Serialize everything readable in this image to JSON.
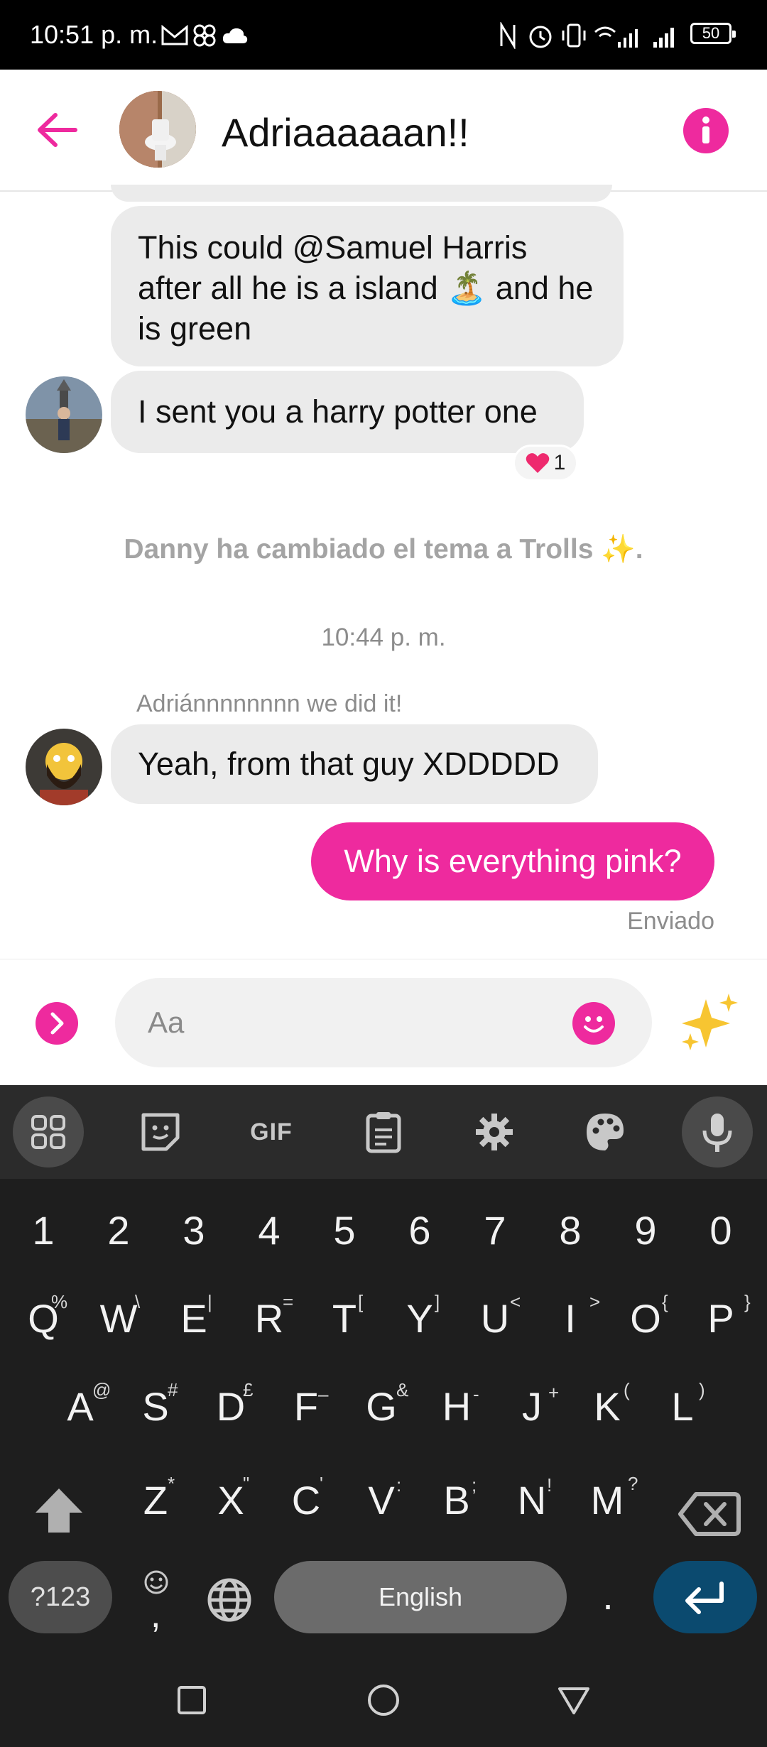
{
  "status_bar": {
    "time": "10:51 p. m.",
    "battery": "50"
  },
  "header": {
    "title": "Adriaaaaaan!!"
  },
  "messages": {
    "msg1": "This could @Samuel Harris after all he is a island 🏝️ and he is green",
    "msg2": "I sent you a harry potter one",
    "reaction_count": "1",
    "system": "Danny ha cambiado el tema a Trolls ✨.",
    "time_separator": "10:44 p. m.",
    "sender_label": "Adriánnnnnnnn we did it!",
    "msg3": "Yeah, from that guy XDDDDD",
    "sent": "Why is everything pink?",
    "sent_status": "Enviado"
  },
  "composer": {
    "placeholder": "Aa"
  },
  "keyboard": {
    "toolbar": [
      "apps-icon",
      "sticker-icon",
      "GIF",
      "clipboard-icon",
      "settings-icon",
      "palette-icon",
      "mic-icon"
    ],
    "gif_label": "GIF",
    "row_numbers": [
      "1",
      "2",
      "3",
      "4",
      "5",
      "6",
      "7",
      "8",
      "9",
      "0"
    ],
    "row1": [
      {
        "k": "Q",
        "s": "%"
      },
      {
        "k": "W",
        "s": "\\"
      },
      {
        "k": "E",
        "s": "|"
      },
      {
        "k": "R",
        "s": "="
      },
      {
        "k": "T",
        "s": "["
      },
      {
        "k": "Y",
        "s": "]"
      },
      {
        "k": "U",
        "s": "<"
      },
      {
        "k": "I",
        "s": ">"
      },
      {
        "k": "O",
        "s": "{"
      },
      {
        "k": "P",
        "s": "}"
      }
    ],
    "row2": [
      {
        "k": "A",
        "s": "@"
      },
      {
        "k": "S",
        "s": "#"
      },
      {
        "k": "D",
        "s": "£"
      },
      {
        "k": "F",
        "s": "–"
      },
      {
        "k": "G",
        "s": "&"
      },
      {
        "k": "H",
        "s": "-"
      },
      {
        "k": "J",
        "s": "+"
      },
      {
        "k": "K",
        "s": "("
      },
      {
        "k": "L",
        "s": ")"
      }
    ],
    "row3": [
      {
        "k": "Z",
        "s": "*"
      },
      {
        "k": "X",
        "s": "\""
      },
      {
        "k": "C",
        "s": "'"
      },
      {
        "k": "V",
        "s": ":"
      },
      {
        "k": "B",
        "s": ";"
      },
      {
        "k": "N",
        "s": "!"
      },
      {
        "k": "M",
        "s": "?"
      }
    ],
    "symbols_key": "?123",
    "comma_key": ",",
    "space_label": "English",
    "period_key": "."
  },
  "colors": {
    "accent": "#ee2a9e",
    "bubble": "#ebebeb",
    "keyboard_bg": "#1e1e1e",
    "enter_key": "#0b4a6f"
  }
}
